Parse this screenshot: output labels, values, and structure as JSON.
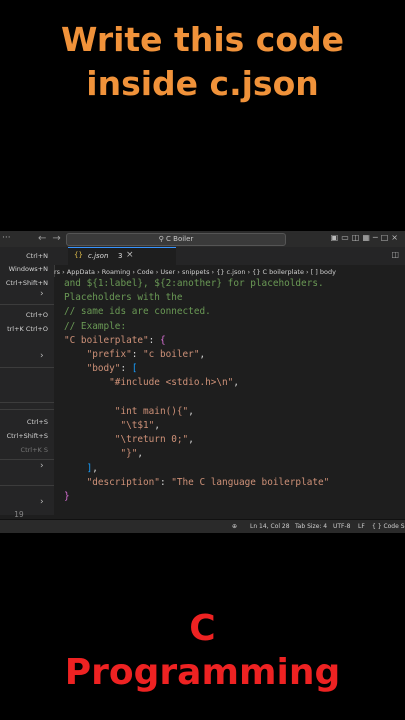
{
  "overlay": {
    "top_line1": "Write this code",
    "top_line2": "inside c.json",
    "bottom_line1": "C",
    "bottom_line2": "Programming",
    "top_color": "#f0923a",
    "bottom_color": "#ee2222"
  },
  "titlebar": {
    "search_text": "C Boiler"
  },
  "menu": {
    "items": [
      {
        "label": "Ctrl+N"
      },
      {
        "label": "Windows+N"
      },
      {
        "label": "Ctrl+Shift+N"
      },
      {
        "label": "Ctrl+O"
      },
      {
        "label": "trl+K Ctrl+O"
      },
      {
        "label": "Ctrl+S"
      },
      {
        "label": "Ctrl+Shift+S"
      },
      {
        "label": "Ctrl+K S"
      }
    ]
  },
  "tab": {
    "name": "c.json",
    "problems": "3",
    "close": "×"
  },
  "breadcrumb": "rs › AppData › Roaming › Code › User › snippets › {} c.json › {} C boilerplate › [ ] body",
  "code_lines": [
    {
      "parts": [
        {
          "t": "and ${1:label}, ${2:another} for placeholders.",
          "c": "cm"
        }
      ]
    },
    {
      "parts": [
        {
          "t": "Placeholders with the",
          "c": "cm"
        }
      ]
    },
    {
      "parts": [
        {
          "t": "// same ids are connected.",
          "c": "cm"
        }
      ]
    },
    {
      "parts": [
        {
          "t": "// Example:",
          "c": "cm"
        }
      ]
    },
    {
      "parts": [
        {
          "t": "\"C boilerplate\"",
          "c": "st"
        },
        {
          "t": ": ",
          "c": "pn"
        },
        {
          "t": "{",
          "c": "br1"
        }
      ]
    },
    {
      "parts": [
        {
          "t": "    \"prefix\"",
          "c": "st"
        },
        {
          "t": ": ",
          "c": "pn"
        },
        {
          "t": "\"c boiler\"",
          "c": "st"
        },
        {
          "t": ",",
          "c": "pn"
        }
      ]
    },
    {
      "parts": [
        {
          "t": "    \"body\"",
          "c": "st"
        },
        {
          "t": ": ",
          "c": "pn"
        },
        {
          "t": "[",
          "c": "br2"
        }
      ]
    },
    {
      "parts": [
        {
          "t": "        \"#include <stdio.h>\\n\"",
          "c": "st"
        },
        {
          "t": ",",
          "c": "pn"
        }
      ]
    },
    {
      "parts": [
        {
          "t": "",
          "c": "pn"
        }
      ]
    },
    {
      "parts": [
        {
          "t": "         \"int main(){\"",
          "c": "st"
        },
        {
          "t": ",",
          "c": "pn"
        }
      ]
    },
    {
      "parts": [
        {
          "t": "          \"\\t$1\"",
          "c": "st"
        },
        {
          "t": ",",
          "c": "pn"
        }
      ]
    },
    {
      "parts": [
        {
          "t": "         \"\\treturn 0;\"",
          "c": "st"
        },
        {
          "t": ",",
          "c": "pn"
        }
      ]
    },
    {
      "parts": [
        {
          "t": "          \"}\"",
          "c": "st"
        },
        {
          "t": ",",
          "c": "pn"
        }
      ]
    },
    {
      "parts": [
        {
          "t": "    ",
          "c": "pn"
        },
        {
          "t": "]",
          "c": "br2"
        },
        {
          "t": ",",
          "c": "pn"
        }
      ]
    },
    {
      "parts": [
        {
          "t": "    \"description\"",
          "c": "st"
        },
        {
          "t": ": ",
          "c": "pn"
        },
        {
          "t": "\"The C language boilerplate\"",
          "c": "st"
        }
      ]
    },
    {
      "parts": [
        {
          "t": "}",
          "c": "br1"
        }
      ]
    }
  ],
  "gutter_last": "19",
  "status": {
    "position": "Ln 14, Col 28",
    "tab_size": "Tab Size: 4",
    "encoding": "UTF-8",
    "eol": "LF",
    "language": "{ } Code Sn"
  },
  "icons": [
    "back-arrow-icon",
    "forward-arrow-icon",
    "search-icon",
    "layout-icon",
    "minimize-icon",
    "maximize-icon",
    "close-icon",
    "json-file-icon",
    "zoom-icon"
  ]
}
